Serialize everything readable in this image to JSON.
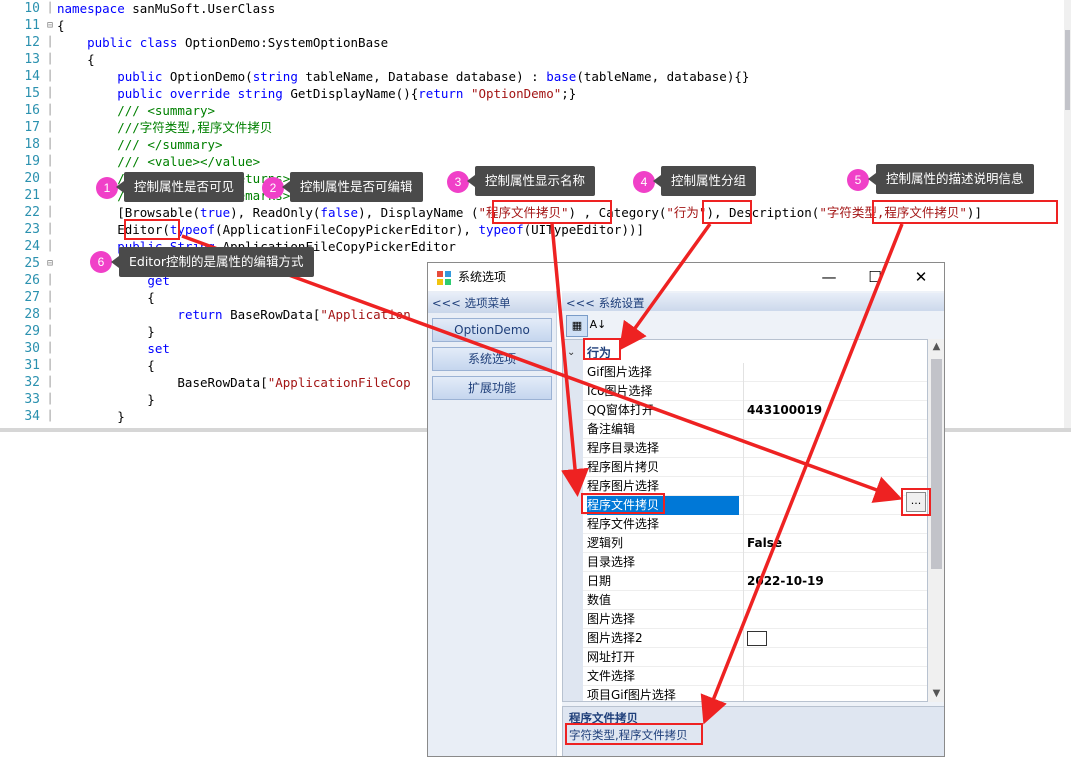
{
  "editor": {
    "lines": [
      {
        "no": "10",
        "fold": "",
        "html": "<span class=\"kw\">namespace</span> sanMuSoft.UserClass"
      },
      {
        "no": "11",
        "fold": "⊟",
        "html": "{"
      },
      {
        "no": "12",
        "fold": "",
        "html": "    <span class=\"kw\">public class</span> OptionDemo:SystemOptionBase"
      },
      {
        "no": "13",
        "fold": "",
        "html": "    {"
      },
      {
        "no": "14",
        "fold": "",
        "html": "        <span class=\"kw\">public</span> OptionDemo(<span class=\"kw\">string</span> tableName, Database database) : <span class=\"kw\">base</span>(tableName, database){}"
      },
      {
        "no": "15",
        "fold": "",
        "html": "        <span class=\"kw\">public override string</span> GetDisplayName(){<span class=\"kw\">return</span> <span class=\"st\">\"OptionDemo\"</span>;}"
      },
      {
        "no": "16",
        "fold": "",
        "html": "        <span class=\"cm\">/// &lt;summary&gt;</span>"
      },
      {
        "no": "17",
        "fold": "",
        "html": "        <span class=\"cm\">///字符类型,程序文件拷贝</span>"
      },
      {
        "no": "18",
        "fold": "",
        "html": "        <span class=\"cm\">/// &lt;/summary&gt;</span>"
      },
      {
        "no": "19",
        "fold": "",
        "html": "        <span class=\"cm\">/// &lt;value&gt;&lt;/value&gt;</span>"
      },
      {
        "no": "20",
        "fold": "",
        "html": "        <span class=\"cm\">/// &lt;returns&gt;&lt;/returns&gt;</span>"
      },
      {
        "no": "21",
        "fold": "",
        "html": "        <span class=\"cm\">/// &lt;remarks&gt;&lt;/remarks&gt;</span>"
      },
      {
        "no": "22",
        "fold": "",
        "html": "        [Browsable(<span class=\"kw\">true</span>), ReadOnly(<span class=\"kw\">false</span>), DisplayName (<span class=\"st\">\"程序文件拷贝\"</span>) , Category(<span class=\"st\">\"行为\"</span>), Description(<span class=\"st\">\"字符类型,程序文件拷贝\"</span>)]"
      },
      {
        "no": "23",
        "fold": "",
        "html": "        Editor(<span class=\"kw\">typeof</span>(ApplicationFileCopyPickerEditor), <span class=\"kw\">typeof</span>(UITypeEditor))]"
      },
      {
        "no": "24",
        "fold": "",
        "html": "        <span class=\"kw\">public</span> <span class=\"kw\">String</span> ApplicationFileCopyPickerEditor"
      },
      {
        "no": "25",
        "fold": "⊟",
        "html": "        {"
      },
      {
        "no": "26",
        "fold": "",
        "html": "            <span class=\"kw\">get</span>"
      },
      {
        "no": "27",
        "fold": "",
        "html": "            {"
      },
      {
        "no": "28",
        "fold": "",
        "html": "                <span class=\"kw\">return</span> BaseRowData[<span class=\"st\">\"Application</span>"
      },
      {
        "no": "29",
        "fold": "",
        "html": "            }"
      },
      {
        "no": "30",
        "fold": "",
        "html": "            <span class=\"kw\">set</span>"
      },
      {
        "no": "31",
        "fold": "",
        "html": "            {"
      },
      {
        "no": "32",
        "fold": "",
        "html": "                BaseRowData[<span class=\"st\">\"ApplicationFileCop</span>"
      },
      {
        "no": "33",
        "fold": "",
        "html": "            }"
      },
      {
        "no": "34",
        "fold": "",
        "html": "        }"
      }
    ]
  },
  "annotations": [
    {
      "num": "1",
      "text": "控制属性是否可见"
    },
    {
      "num": "2",
      "text": "控制属性是否可编辑"
    },
    {
      "num": "3",
      "text": "控制属性显示名称"
    },
    {
      "num": "4",
      "text": "控制属性分组"
    },
    {
      "num": "5",
      "text": "控制属性的描述说明信息"
    },
    {
      "num": "6",
      "text": "Editor控制的是属性的编辑方式"
    }
  ],
  "dialog": {
    "title": "系统选项",
    "controls": {
      "minimize": "—",
      "maximize": "☐",
      "close": "✕"
    },
    "left_header": "<<< 选项菜单",
    "menu": [
      "OptionDemo",
      "系统选项",
      "扩展功能"
    ],
    "right_header": "<<< 系统设置",
    "toolbar": {
      "categorized": "▦",
      "alphabetical": "A↓"
    },
    "category": {
      "toggle": "⌄",
      "label": "行为"
    },
    "rows": [
      {
        "name": "Gif图片选择",
        "value": ""
      },
      {
        "name": "Ico图片选择",
        "value": ""
      },
      {
        "name": "QQ窗体打开",
        "value": "443100019"
      },
      {
        "name": "备注编辑",
        "value": ""
      },
      {
        "name": "程序目录选择",
        "value": ""
      },
      {
        "name": "程序图片拷贝",
        "value": ""
      },
      {
        "name": "程序图片选择",
        "value": ""
      },
      {
        "name": "程序文件拷贝",
        "value": "",
        "selected": true
      },
      {
        "name": "程序文件选择",
        "value": ""
      },
      {
        "name": "逻辑列",
        "value": "False"
      },
      {
        "name": "目录选择",
        "value": ""
      },
      {
        "name": "日期",
        "value": "2022-10-19"
      },
      {
        "name": "数值",
        "value": ""
      },
      {
        "name": "图片选择",
        "value": ""
      },
      {
        "name": "图片选择2",
        "value": "",
        "color": true
      },
      {
        "name": "网址打开",
        "value": ""
      },
      {
        "name": "文件选择",
        "value": ""
      },
      {
        "name": "项目Gif图片选择",
        "value": ""
      }
    ],
    "description": {
      "title": "程序文件拷贝",
      "text": "字符类型,程序文件拷贝"
    },
    "ellipsis": "..."
  },
  "colors": {
    "accent": "#0078d7",
    "annotation_red": "#ee2222",
    "badge": "#f040c8"
  }
}
